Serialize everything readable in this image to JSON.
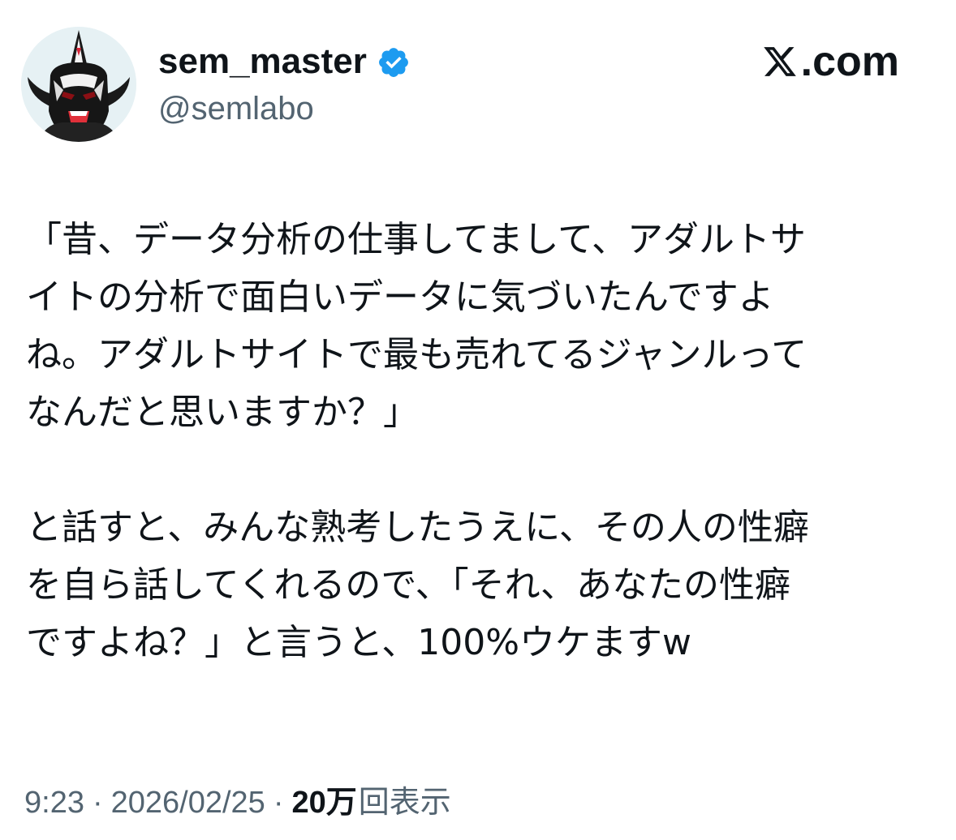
{
  "author": {
    "display_name": "sem_master",
    "handle": "@semlabo",
    "verified": true,
    "avatar_icon": "masked-wrestler-avatar"
  },
  "brand": {
    "label": ".com",
    "icon": "x-logo-icon"
  },
  "tweet": {
    "paragraph_1": "「昔、データ分析の仕事してまして、アダルトサ\nイトの分析で面白いデータに気づいたんですよ\nね。アダルトサイトで最も売れてるジャンルって\nなんだと思いますか？」",
    "paragraph_2": "と話すと、みんな熟考したうえに、その人の性癖\nを自ら話してくれるので、「それ、あなたの性癖\nですよね？」と言うと、100%ウケますw"
  },
  "meta": {
    "time": "9:23",
    "separator": "·",
    "date": "2026/02/25",
    "views_count": "20万",
    "views_label": "回表示"
  },
  "colors": {
    "text": "#0f1419",
    "secondary": "#536471",
    "verified_blue": "#1d9bf0"
  }
}
